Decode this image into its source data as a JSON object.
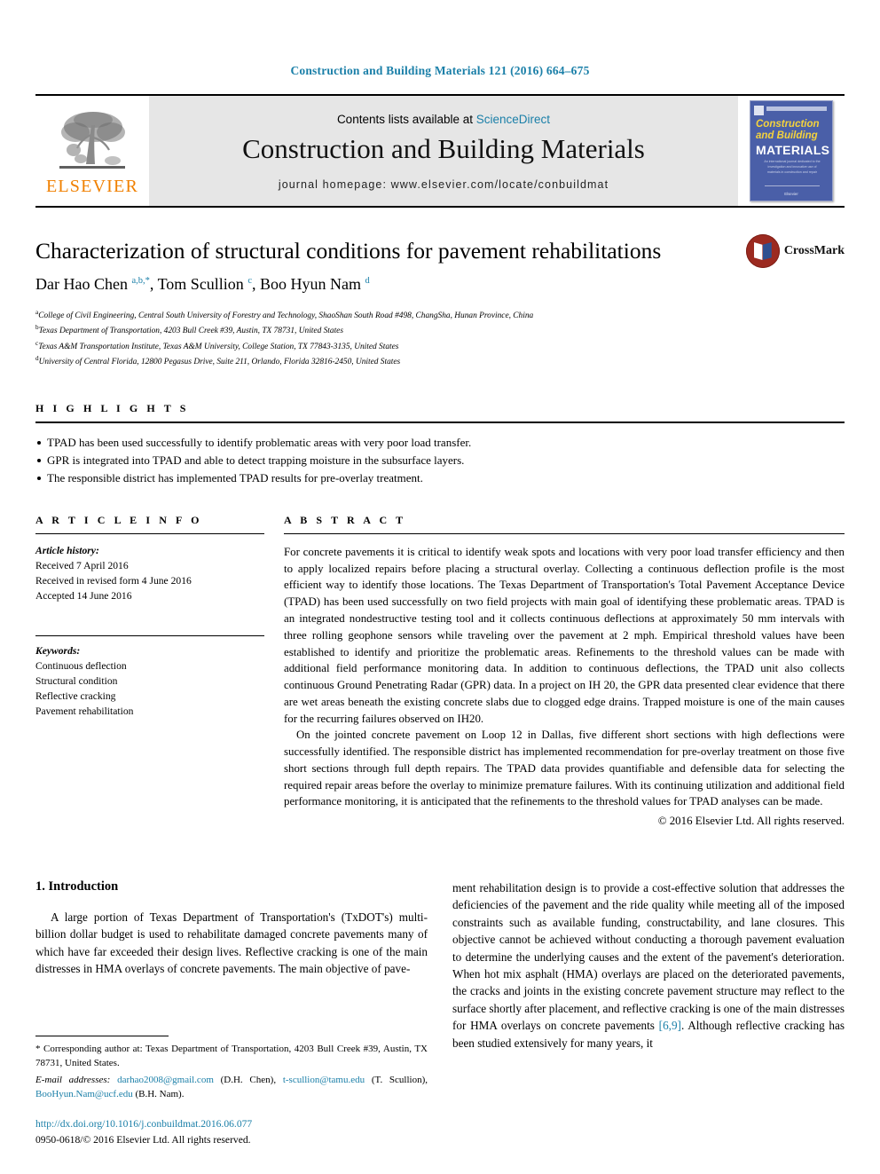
{
  "running_head": "Construction and Building Materials 121 (2016) 664–675",
  "masthead": {
    "contents_prefix": "Contents lists available at ",
    "sciencedirect": "ScienceDirect",
    "journal_name": "Construction and Building Materials",
    "homepage": "journal homepage: www.elsevier.com/locate/conbuildmat",
    "publisher_wordmark": "ELSEVIER",
    "cover": {
      "line1": "Construction",
      "line2": "and Building",
      "line3": "MATERIALS",
      "blurb": "An international journal dedicated to the investigation and innovative use of materials in construction and repair",
      "footer": "Elsevier"
    }
  },
  "article": {
    "title": "Characterization of structural conditions for pavement rehabilitations",
    "authors_html": "Dar Hao Chen <sup>a,b,*</sup>, Tom Scullion <sup>c</sup>, Boo Hyun Nam <sup>d</sup>",
    "crossmark_label": "CrossMark",
    "affiliations": [
      "College of Civil Engineering, Central South University of Forestry and Technology, ShaoShan South Road #498, ChangSha, Hunan Province, China",
      "Texas Department of Transportation, 4203 Bull Creek #39, Austin, TX 78731, United States",
      "Texas A&M Transportation Institute, Texas A&M University, College Station, TX 77843-3135, United States",
      "University of Central Florida, 12800 Pegasus Drive, Suite 211, Orlando, Florida 32816-2450, United States"
    ],
    "affiliation_marks": [
      "a",
      "b",
      "c",
      "d"
    ]
  },
  "highlights": {
    "heading": "H I G H L I G H T S",
    "items": [
      "TPAD has been used successfully to identify problematic areas with very poor load transfer.",
      "GPR is integrated into TPAD and able to detect trapping moisture in the subsurface layers.",
      "The responsible district has implemented TPAD results for pre-overlay treatment."
    ]
  },
  "article_info": {
    "heading": "A R T I C L E    I N F O",
    "history_label": "Article history:",
    "history": [
      "Received 7 April 2016",
      "Received in revised form 4 June 2016",
      "Accepted 14 June 2016"
    ],
    "keywords_label": "Keywords:",
    "keywords": [
      "Continuous deflection",
      "Structural condition",
      "Reflective cracking",
      "Pavement rehabilitation"
    ]
  },
  "abstract": {
    "heading": "A B S T R A C T",
    "paragraph1": "For concrete pavements it is critical to identify weak spots and locations with very poor load transfer efficiency and then to apply localized repairs before placing a structural overlay. Collecting a continuous deflection profile is the most efficient way to identify those locations. The Texas Department of Transportation's Total Pavement Acceptance Device (TPAD) has been used successfully on two field projects with main goal of identifying these problematic areas. TPAD is an integrated nondestructive testing tool and it collects continuous deflections at approximately 50 mm intervals with three rolling geophone sensors while traveling over the pavement at 2 mph. Empirical threshold values have been established to identify and prioritize the problematic areas. Refinements to the threshold values can be made with additional field performance monitoring data. In addition to continuous deflections, the TPAD unit also collects continuous Ground Penetrating Radar (GPR) data. In a project on IH 20, the GPR data presented clear evidence that there are wet areas beneath the existing concrete slabs due to clogged edge drains. Trapped moisture is one of the main causes for the recurring failures observed on IH20.",
    "paragraph2": "On the jointed concrete pavement on Loop 12 in Dallas, five different short sections with high deflections were successfully identified. The responsible district has implemented recommendation for pre-overlay treatment on those five short sections through full depth repairs. The TPAD data provides quantifiable and defensible data for selecting the required repair areas before the overlay to minimize premature failures. With its continuing utilization and additional field performance monitoring, it is anticipated that the refinements to the threshold values for TPAD analyses can be made.",
    "copyright": "© 2016 Elsevier Ltd. All rights reserved."
  },
  "body": {
    "section_heading": "1. Introduction",
    "left_paragraph": "A large portion of Texas Department of Transportation's (TxDOT's) multi-billion dollar budget is used to rehabilitate damaged concrete pavements many of which have far exceeded their design lives. Reflective cracking is one of the main distresses in HMA overlays of concrete pavements. The main objective of pave-",
    "right_paragraph_pre": "ment rehabilitation design is to provide a cost-effective solution that addresses the deficiencies of the pavement and the ride quality while meeting all of the imposed constraints such as available funding, constructability, and lane closures. This objective cannot be achieved without conducting a thorough pavement evaluation to determine the underlying causes and the extent of the pavement's deterioration. When hot mix asphalt (HMA) overlays are placed on the deteriorated pavements, the cracks and joints in the existing concrete pavement structure may reflect to the surface shortly after placement, and reflective cracking is one of the main distresses for HMA overlays on concrete pavements ",
    "right_citation": "[6,9]",
    "right_paragraph_post": ". Although reflective cracking has been studied extensively for many years, it"
  },
  "footnotes": {
    "corresponding": "* Corresponding author at: Texas Department of Transportation, 4203 Bull Creek #39, Austin, TX 78731, United States.",
    "email_label": "E-mail addresses:",
    "emails": [
      {
        "address": "darhao2008@gmail.com",
        "owner": "(D.H. Chen)"
      },
      {
        "address": "t-scullion@tamu.edu",
        "owner": "(T. Scullion)"
      },
      {
        "address": "BooHyun.Nam@ucf.edu",
        "owner": "(B.H. Nam)"
      }
    ],
    "doi": "http://dx.doi.org/10.1016/j.conbuildmat.2016.06.077",
    "issn_line": "0950-0618/© 2016 Elsevier Ltd. All rights reserved."
  },
  "colors": {
    "link_blue": "#1a7fa8",
    "elsevier_orange": "#f08000",
    "cover_blue": "#4a5fa8",
    "crossmark_red": "#9c2a20"
  }
}
